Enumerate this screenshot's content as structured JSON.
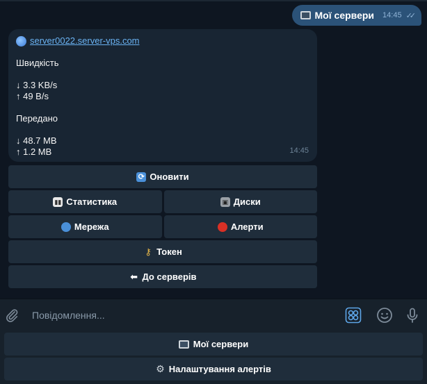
{
  "chat": {
    "outgoing": {
      "text": "Мої сервери",
      "time": "14:45",
      "ticks": "✓✓"
    },
    "incoming": {
      "link": "server0022.server-vps.com",
      "speed_title": "Швидкість",
      "speed_down": "↓ 3.3 KB/s",
      "speed_up": "↑ 49 B/s",
      "transfer_title": "Передано",
      "transfer_down": "↓ 48.7 MB",
      "transfer_up": "↑ 1.2 MB",
      "time": "14:45"
    }
  },
  "inline_keyboard": {
    "refresh": "Оновити",
    "stats": "Статистика",
    "disks": "Диски",
    "network": "Мережа",
    "alerts": "Алерти",
    "token": "Токен",
    "back": "До серверів"
  },
  "composer": {
    "placeholder": "Повідомлення..."
  },
  "reply_keyboard": {
    "my_servers": "Мої сервери",
    "alert_settings": "Налаштування алертів"
  },
  "colors": {
    "background": "#0e1621",
    "outgoing_bubble": "#2b5278",
    "incoming_bubble": "#182533",
    "button": "#1f2d3b",
    "link": "#6ab3f3",
    "accent": "#5ea6e8"
  },
  "icons": {
    "refresh": "refresh-icon",
    "stats": "bar-chart-icon",
    "disks": "floppy-disk-icon",
    "network": "globe-icon",
    "alerts": "siren-icon",
    "token": "key-icon",
    "back": "arrow-left-icon",
    "monitor": "monitor-icon",
    "gear": "gear-icon"
  }
}
